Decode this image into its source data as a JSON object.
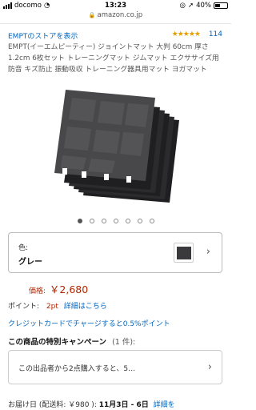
{
  "status_bar": {
    "carrier": "docomo",
    "time": "13:23",
    "battery": "40%"
  },
  "browser": {
    "url": "amazon.co.jp"
  },
  "product": {
    "store_link": "EMPTのストアを表示",
    "rating_stars": "★★★★★",
    "review_count": "114",
    "title": "EMPT(イーエムピーティー) ジョイントマット 大判 60cm 厚さ1.2cm 6枚セット トレーニングマット ジムマット エクササイズ用 防音 キズ防止 振動吸収 トレーニング器具用マット ヨガマット",
    "image_count": 7,
    "active_image": 1
  },
  "variant": {
    "label": "色:",
    "value": "グレー"
  },
  "price": {
    "label": "価格:",
    "value": "￥2,680"
  },
  "points": {
    "label": "ポイント:",
    "value": "2pt",
    "details_link": "詳細はこちら"
  },
  "credit_promo": "クレジットカードでチャージすると0.5%ポイント",
  "campaign": {
    "heading": "この商品の特別キャンペーン",
    "count": "(1 件):",
    "item_text": "この出品者から2点購入すると、5…"
  },
  "delivery": {
    "prefix": "お届け日 (配送料: ￥980 ):",
    "dates": "11月3日 - 6日",
    "details_link": "詳細を"
  },
  "colors": {
    "link": "#0066c0",
    "price": "#b12704",
    "star": "#e5a000"
  }
}
